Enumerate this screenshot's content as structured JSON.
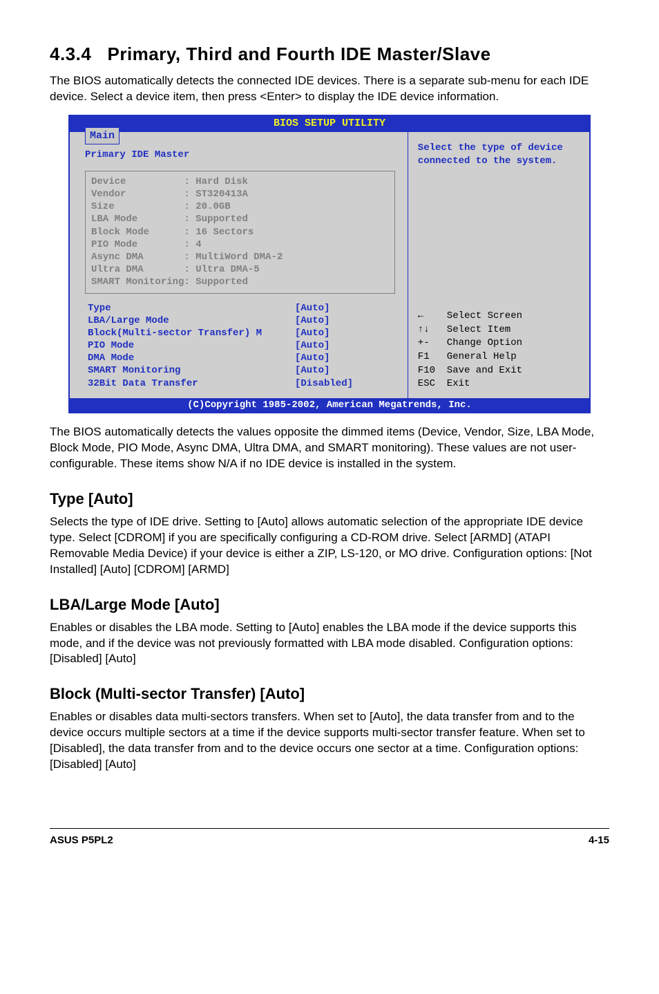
{
  "section": {
    "number": "4.3.4",
    "title": "Primary, Third and Fourth IDE Master/Slave",
    "intro": "The BIOS automatically detects the connected IDE devices. There is a separate sub-menu for each IDE device. Select a device item, then press <Enter> to display the IDE device information."
  },
  "bios": {
    "title": "BIOS SETUP UTILITY",
    "tab": "Main",
    "panel_title": "Primary IDE Master",
    "info": [
      {
        "label": "Device",
        "value": "Hard Disk"
      },
      {
        "label": "Vendor",
        "value": "ST320413A"
      },
      {
        "label": "Size",
        "value": "20.0GB"
      },
      {
        "label": "LBA Mode",
        "value": "Supported"
      },
      {
        "label": "Block Mode",
        "value": "16 Sectors"
      },
      {
        "label": "PIO Mode",
        "value": "4"
      },
      {
        "label": "Async DMA",
        "value": "MultiWord DMA-2"
      },
      {
        "label": "Ultra DMA",
        "value": "Ultra DMA-5"
      },
      {
        "label": "SMART Monitoring",
        "value": "Supported"
      }
    ],
    "settings": [
      {
        "label": "Type",
        "value": "[Auto]"
      },
      {
        "label": "LBA/Large Mode",
        "value": "[Auto]"
      },
      {
        "label": "Block(Multi-sector Transfer) M",
        "value": "[Auto]"
      },
      {
        "label": "PIO Mode",
        "value": "[Auto]"
      },
      {
        "label": "DMA Mode",
        "value": "[Auto]"
      },
      {
        "label": "SMART Monitoring",
        "value": "[Auto]"
      },
      {
        "label": "32Bit Data Transfer",
        "value": "[Disabled]"
      }
    ],
    "help_top": "Select the type of device connected to the system.",
    "help_keys": [
      {
        "key": "←",
        "desc": "Select Screen"
      },
      {
        "key": "↑↓",
        "desc": "Select Item"
      },
      {
        "key": "+-",
        "desc": "Change Option"
      },
      {
        "key": "F1",
        "desc": "General Help"
      },
      {
        "key": "F10",
        "desc": "Save and Exit"
      },
      {
        "key": "ESC",
        "desc": "Exit"
      }
    ],
    "footer": "(C)Copyright 1985-2002, American Megatrends, Inc."
  },
  "paragraphs": {
    "after_bios": "The BIOS automatically detects the values opposite the dimmed items (Device, Vendor, Size, LBA Mode, Block Mode, PIO Mode, Async DMA, Ultra DMA, and SMART monitoring). These values are not user-configurable. These items show N/A if no IDE device is installed in the system.",
    "type_heading": "Type [Auto]",
    "type_body": "Selects the type of IDE drive. Setting to [Auto] allows automatic selection of the appropriate IDE device type. Select [CDROM] if you are specifically configuring a CD-ROM drive. Select [ARMD] (ATAPI Removable Media Device) if your device is either a ZIP, LS-120, or MO drive. Configuration options: [Not Installed] [Auto] [CDROM] [ARMD]",
    "lba_heading": "LBA/Large Mode [Auto]",
    "lba_body": "Enables or disables the LBA mode. Setting to [Auto] enables the LBA mode if the device supports this mode, and if the device was not previously formatted with LBA mode disabled. Configuration options: [Disabled] [Auto]",
    "block_heading": "Block (Multi-sector Transfer) [Auto]",
    "block_body": "Enables or disables data multi-sectors transfers. When set to [Auto], the data transfer from and to the device occurs multiple sectors at a time if the device supports multi-sector transfer feature. When set to [Disabled], the data transfer from and to the device occurs one sector at a time. Configuration options: [Disabled] [Auto]"
  },
  "footer": {
    "left": "ASUS P5PL2",
    "right": "4-15"
  }
}
